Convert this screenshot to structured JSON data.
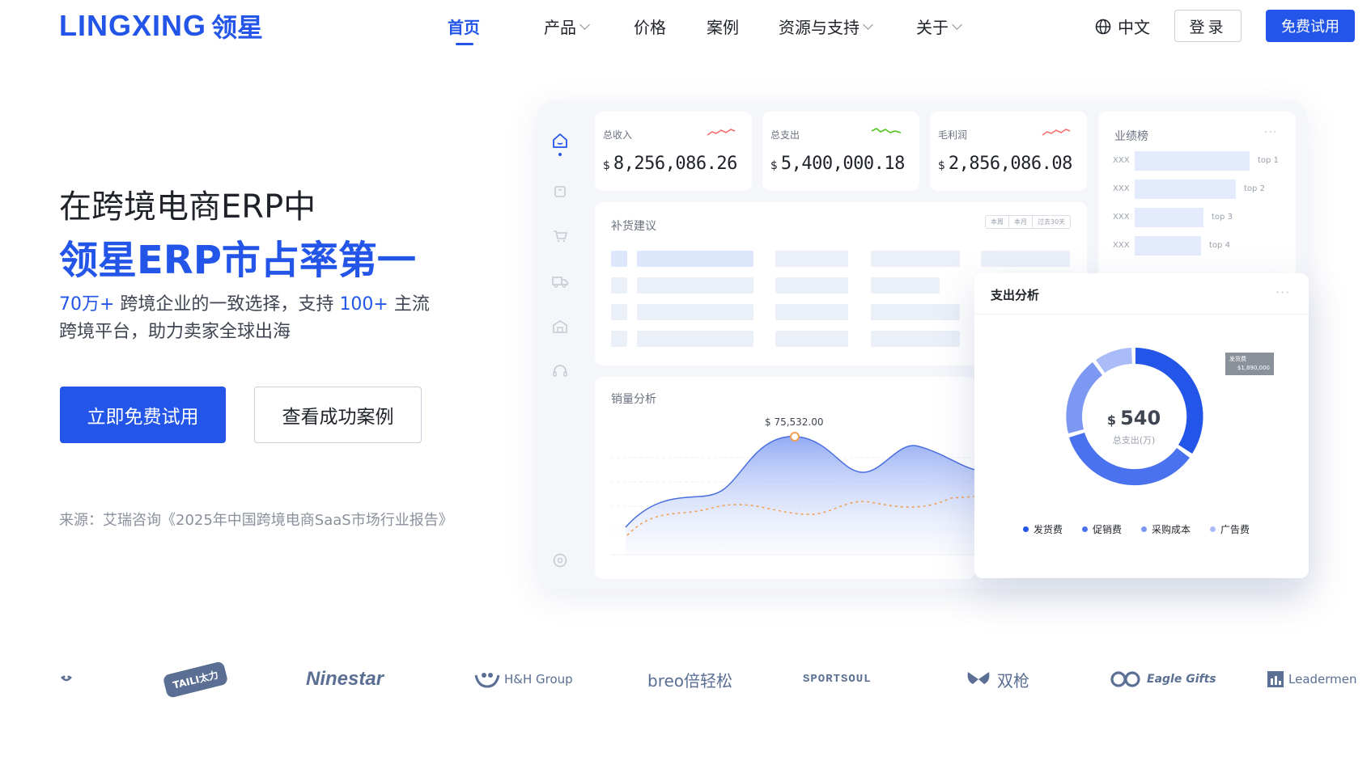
{
  "brand": {
    "logo_en": "LINGXING",
    "logo_cn": "领星",
    "color": "#2255e8"
  },
  "nav": {
    "items": [
      {
        "label": "首页",
        "active": true,
        "dropdown": false
      },
      {
        "label": "产品",
        "active": false,
        "dropdown": true
      },
      {
        "label": "价格",
        "active": false,
        "dropdown": false
      },
      {
        "label": "案例",
        "active": false,
        "dropdown": false
      },
      {
        "label": "资源与支持",
        "active": false,
        "dropdown": true
      },
      {
        "label": "关于",
        "active": false,
        "dropdown": true
      }
    ],
    "language": "中文",
    "login": "登录",
    "trial": "免费试用"
  },
  "hero": {
    "line1": "在跨境电商ERP中",
    "line2": "领星ERP市占率第一",
    "sub_stat1": "70万+",
    "sub_text1": " 跨境企业的一致选择，支持 ",
    "sub_stat2": "100+",
    "sub_text2": " 主流",
    "sub_line2": "跨境平台，助力卖家全球出海",
    "primary_cta": "立即免费试用",
    "secondary_cta": "查看成功案例",
    "source": "来源：艾瑞咨询《2025年中国跨境电商SaaS市场行业报告》"
  },
  "dashboard": {
    "kpis": [
      {
        "label": "总收入",
        "currency": "$",
        "value": "8,256,086.26",
        "trend_color": "#f56c6c"
      },
      {
        "label": "总支出",
        "currency": "$",
        "value": "5,400,000.18",
        "trend_color": "#52c41a"
      },
      {
        "label": "毛利润",
        "currency": "$",
        "value": "2,856,086.08",
        "trend_color": "#f56c6c"
      }
    ],
    "restock": {
      "title": "补货建议",
      "tabs": [
        "本周",
        "本月",
        "过去30天"
      ]
    },
    "ranking": {
      "title": "业绩榜",
      "rows": [
        {
          "name": "XXX",
          "rank": "top 1",
          "value": 1.0
        },
        {
          "name": "XXX",
          "rank": "top 2",
          "value": 0.88
        },
        {
          "name": "XXX",
          "rank": "top 3",
          "value": 0.6
        },
        {
          "name": "XXX",
          "rank": "top 4",
          "value": 0.58
        }
      ]
    },
    "sales": {
      "title": "销量分析",
      "peak_label": "$ 75,532.00"
    },
    "expense": {
      "title": "支出分析",
      "center_currency": "$",
      "center_value": "540",
      "center_label": "总支出(万)",
      "tooltip_name": "发货费",
      "tooltip_value": "$1,890,000",
      "legend": [
        {
          "label": "发货费",
          "color": "#2255e8"
        },
        {
          "label": "促销费",
          "color": "#4a72ee"
        },
        {
          "label": "采购成本",
          "color": "#7c98f2"
        },
        {
          "label": "广告费",
          "color": "#a9bcf7"
        }
      ]
    }
  },
  "customers": [
    "TAILI太力",
    "Ninestar",
    "H&H Group",
    "breo倍轻松",
    "SPORTSOUL",
    "双枪",
    "Eagle Gifts",
    "Leadermen"
  ]
}
